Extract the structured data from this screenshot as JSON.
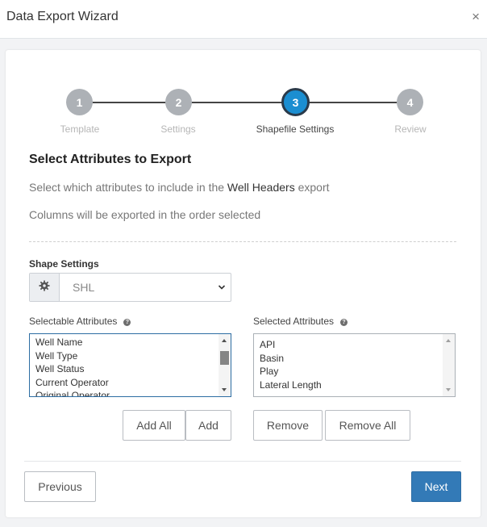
{
  "dialog": {
    "title": "Data Export Wizard",
    "close_symbol": "×"
  },
  "steps": [
    {
      "number": "1",
      "label": "Template",
      "state": "inactive"
    },
    {
      "number": "2",
      "label": "Settings",
      "state": "inactive"
    },
    {
      "number": "3",
      "label": "Shapefile Settings",
      "state": "active"
    },
    {
      "number": "4",
      "label": "Review",
      "state": "inactive"
    }
  ],
  "content": {
    "heading": "Select Attributes to Export",
    "desc1_before": "Select which attributes to include in the ",
    "desc1_highlight": "Well Headers",
    "desc1_after": " export",
    "desc2": "Columns will be exported in the order selected"
  },
  "shape_settings": {
    "label": "Shape Settings",
    "icon": "gear-icon",
    "selected": "SHL"
  },
  "selectable": {
    "label": "Selectable Attributes",
    "help": "?",
    "items": [
      "Well Name",
      "Well Type",
      "Well Status",
      "Current Operator",
      "Original Operator"
    ]
  },
  "selected": {
    "label": "Selected Attributes",
    "help": "?",
    "items": [
      "API",
      "Basin",
      "Play",
      "Lateral Length"
    ]
  },
  "buttons": {
    "add_all": "Add All",
    "add": "Add",
    "remove": "Remove",
    "remove_all": "Remove All",
    "previous": "Previous",
    "next": "Next"
  },
  "colors": {
    "active_step": "#1b8ed1",
    "inactive_step": "#adb1b6",
    "primary_button": "#337ab7"
  }
}
